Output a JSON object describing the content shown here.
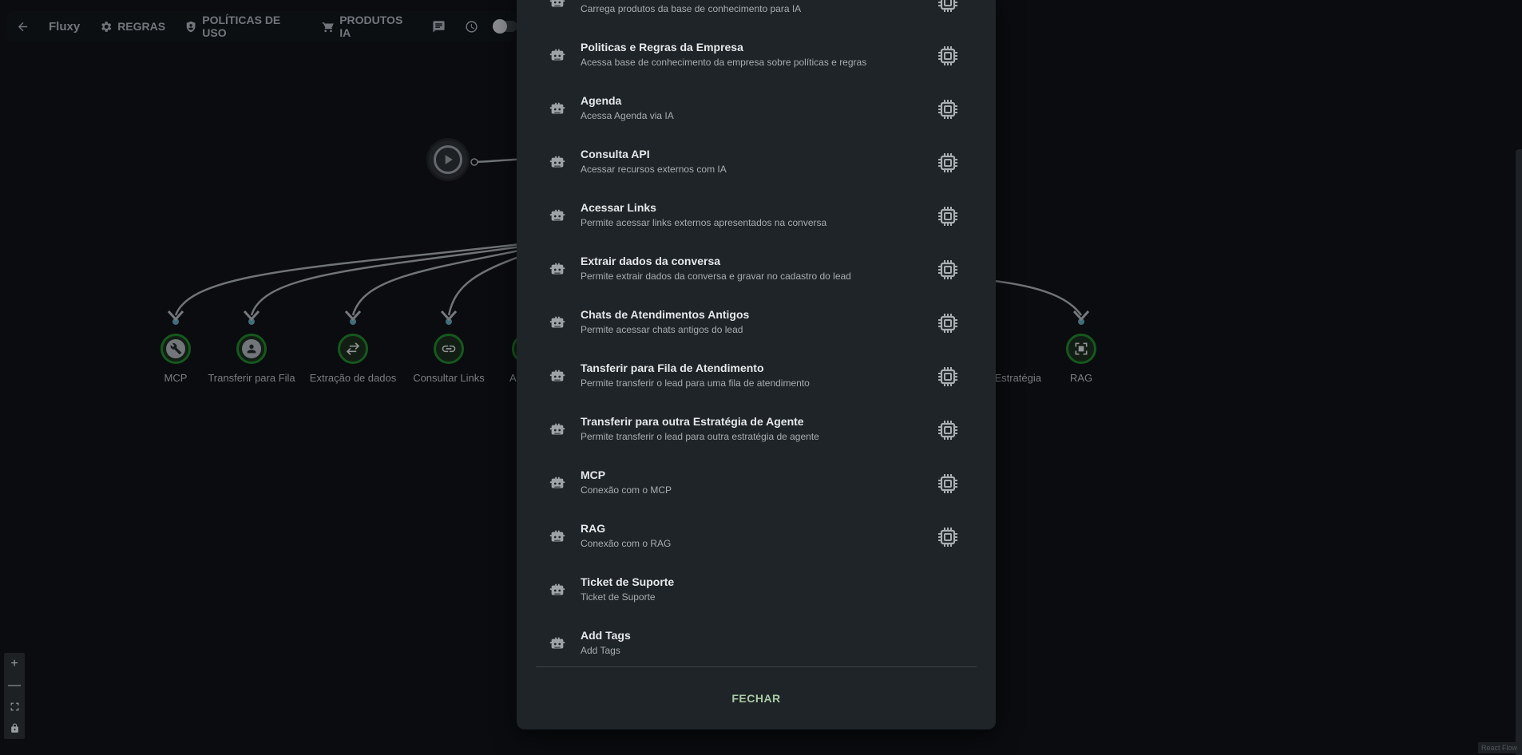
{
  "toolbar": {
    "brand": "Fluxy",
    "rules_label": "REGRAS",
    "policies_label": "POLÍTICAS DE USO",
    "products_label": "PRODUTOS IA"
  },
  "flow": {
    "nodes": [
      {
        "label": "MCP",
        "icon": "wrench-icon"
      },
      {
        "label": "Transferir para Fila",
        "icon": "person-icon"
      },
      {
        "label": "Extração de dados",
        "icon": "swap-icon"
      },
      {
        "label": "Consultar Links",
        "icon": "link-icon"
      },
      {
        "label": "A",
        "icon": "generic-icon"
      },
      {
        "label": "Estratégia",
        "icon": "generic-icon"
      },
      {
        "label": "RAG",
        "icon": "frame-icon"
      }
    ]
  },
  "modal": {
    "items": [
      {
        "title": "",
        "desc": "Carrega produtos da base de conhecimento para IA",
        "configurable": true
      },
      {
        "title": "Politicas e Regras da Empresa",
        "desc": "Acessa base de conhecimento da empresa sobre políticas e regras",
        "configurable": true
      },
      {
        "title": "Agenda",
        "desc": "Acessa Agenda via IA",
        "configurable": true
      },
      {
        "title": "Consulta API",
        "desc": "Acessar recursos externos com IA",
        "configurable": true
      },
      {
        "title": "Acessar Links",
        "desc": "Permite acessar links externos apresentados na conversa",
        "configurable": true
      },
      {
        "title": "Extrair dados da conversa",
        "desc": "Permite extrair dados da conversa e gravar no cadastro do lead",
        "configurable": true
      },
      {
        "title": "Chats de Atendimentos Antigos",
        "desc": "Permite acessar chats antigos do lead",
        "configurable": true
      },
      {
        "title": "Tansferir para Fila de Atendimento",
        "desc": "Permite transferir o lead para uma fila de atendimento",
        "configurable": true
      },
      {
        "title": "Transferir para outra Estratégia de Agente",
        "desc": "Permite transferir o lead para outra estratégia de agente",
        "configurable": true
      },
      {
        "title": "MCP",
        "desc": "Conexão com o MCP",
        "configurable": true
      },
      {
        "title": "RAG",
        "desc": "Conexão com o RAG",
        "configurable": true
      },
      {
        "title": "Ticket de Suporte",
        "desc": "Ticket de Suporte",
        "configurable": false
      },
      {
        "title": "Add Tags",
        "desc": "Add Tags",
        "configurable": false
      }
    ],
    "close_label": "FECHAR"
  },
  "zoom": {
    "plus": "+",
    "minus": "—"
  },
  "attribution": "React Flow",
  "colors": {
    "accent_green": "#1f7a2a",
    "close_text": "#a9c9a4",
    "modal_bg": "#1f2428"
  }
}
